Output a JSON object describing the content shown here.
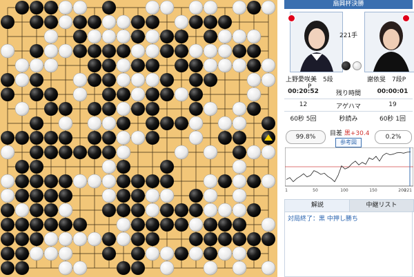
{
  "board": {
    "size": 19,
    "rows": [
      ".BBBWW.B..WW.WW.WBW",
      "B.BBWBBWWBB.WBBB...",
      "...W.BWWWBWBB.BWWW.",
      "W.BWWBBBBWWBBWWWBB.",
      ".WWW..BBWBB.BBWWWBW",
      "BWB..WBBWWWB.BB..WW",
      "B.BB.W.BBWBBWB...W.",
      ".W.BB.BBWBB..BW.WB.",
      "..B.W.WWB.BBBW.WW.B",
      "BBBBB.BBWWB..W.BB.B",
      "W.BBBBBBW...W.W.BWW",
      ".BB....WB..B....W..",
      "WBBBBWWWBBBB..WBWBW",
      "WBBBB..WBBWW.BW.W..",
      "BWBBW..BBBWBBBWWWB.",
      "BBBBBB..WBBBBWBBB.W",
      "BBBWWWWBWBB..BBBBBB",
      "BBWWW..B.BWWBWBWWB.",
      "BB..WW..BB.W..W.W.W"
    ],
    "last_move_marker": "triangle-marker"
  },
  "header": {
    "banner": "扇興杯決勝"
  },
  "players": {
    "black": {
      "name": "上野愛咲美　5段",
      "name_extra": "P",
      "time_left": "00:20:52",
      "captures": "12",
      "byoyomi": "60秒 5回",
      "stone_color": "#111111"
    },
    "white": {
      "name": "謝依旻　7段P",
      "time_left": "00:00:01",
      "captures": "19",
      "byoyomi": "60秒 1回",
      "stone_color": "#f4f4f4"
    }
  },
  "game": {
    "move_count": "221手",
    "time_label": "残り時間",
    "captures_label": "アゲハマ",
    "byoyomi_label": "秒読み"
  },
  "ai": {
    "black_win_rate": "99.8%",
    "white_win_rate": "0.2%",
    "margin_label": "目差",
    "margin_value": "黒+30.4",
    "reference_button": "参考図",
    "graph_values": [
      0.12,
      0.18,
      0.05,
      0.15,
      0.22,
      0.3,
      0.2,
      0.25,
      0.4,
      0.35,
      0.28,
      0.32,
      0.22,
      0.15,
      0.05,
      0.25,
      0.55,
      0.45,
      0.5,
      0.62,
      0.7,
      0.58,
      0.66,
      0.6,
      0.8,
      0.75,
      0.85,
      0.7,
      0.88,
      0.95,
      0.9,
      0.92,
      0.96,
      0.97,
      0.95,
      0.98,
      0.99
    ],
    "graph_ticks": [
      "1",
      "50",
      "100",
      "150",
      "200",
      "221"
    ]
  },
  "tabs": {
    "commentary": "解説",
    "relay_list": "中継リスト"
  },
  "commentary": {
    "text": "対局終了：黒 中押し勝ち"
  },
  "colors": {
    "board": "#f2c678",
    "accent": "#3a6fb0",
    "flag": "#e0001a",
    "margin_red": "#d0312d"
  }
}
